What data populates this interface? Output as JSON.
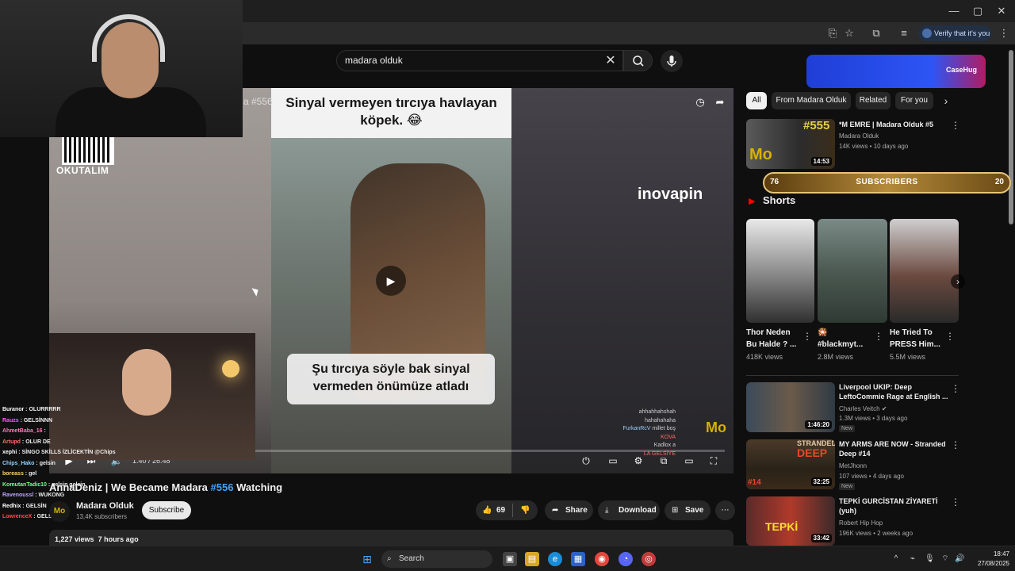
{
  "browser": {
    "verify_label": "Verify that it's you",
    "window_controls": [
      "—",
      "▢",
      "✕"
    ]
  },
  "search": {
    "query": "madara olduk"
  },
  "player": {
    "overlay_title": "a #556",
    "caption_top": "Sinyal vermeyen tırcıya havlayan köpek. 😂",
    "caption_bottom": "Şu tırcıya söyle bak sinyal vermeden önümüze atladı",
    "sponsor": "inovapin",
    "qr_label": "OKUTALIM",
    "time": "1:40 / 26:48",
    "progress": 0.063,
    "logo": "Mo"
  },
  "chat_in_player": [
    {
      "name": "",
      "msg": "ahhahhahshah"
    },
    {
      "name": "",
      "msg": "hahahahaha"
    },
    {
      "name": "FurkanRcV",
      "msg": "millet boş"
    },
    {
      "name": "KOVA",
      "msg": ""
    },
    {
      "name": "Kadlox",
      "msg": "a"
    },
    {
      "name": "",
      "msg": "LA GELSİYE"
    }
  ],
  "chat_left": [
    {
      "name": "Buranor",
      "color": "#ffffff",
      "msg": "OLURRRRR"
    },
    {
      "name": "Rauzs",
      "color": "#ff5cf4",
      "msg": "GELSİNNN"
    },
    {
      "name": "AhmetBaba_16",
      "color": "#ff7ab8",
      "msg": ""
    },
    {
      "name": "Artupd",
      "color": "#ff6b6b",
      "msg": "OLUR DE"
    },
    {
      "name": "xephi",
      "color": "#ffffff",
      "msg": "SİNGO SKİLLS İZLİCEKTİN @Chips"
    },
    {
      "name": "Chips_Hako",
      "color": "#8fd3ff",
      "msg": "gelsin"
    },
    {
      "name": "boreass",
      "color": "#ffd36b",
      "msg": "gel"
    },
    {
      "name": "KomutanTadic10",
      "color": "#7cff8a",
      "msg": "gelsin gelsin"
    },
    {
      "name": "Ravenoussl",
      "color": "#bba8ff",
      "msg": "WUKONG"
    },
    {
      "name": "Redhix",
      "color": "#ffffff",
      "msg": "GELSİN"
    },
    {
      "name": "LowrenceX",
      "color": "#ff4b4b",
      "msg": "GELSİN"
    }
  ],
  "video": {
    "title_prefix": "AnnaDeniz | We Became Madara ",
    "title_hash": "#556",
    "title_suffix": " Watching",
    "channel": "Madara Olduk",
    "subs": "13,4K subscribers",
    "subscribe": "Subscribe",
    "likes": "69",
    "share": "Share",
    "download": "Download",
    "save": "Save",
    "views": "1,227 views",
    "age": "7 hours ago"
  },
  "chips": [
    "All",
    "From Madara Olduk",
    "Related",
    "For you"
  ],
  "subs_bar": {
    "left": "76",
    "label": "SUBSCRIBERS",
    "right": "20"
  },
  "casehug": {
    "label": "CaseHug"
  },
  "shorts_heading": "Shorts",
  "related_top": {
    "title": "*M EMRE | Madara Olduk #5",
    "channel": "Madara Olduk",
    "meta": "14K views • 10 days ago",
    "duration": "14:53",
    "thumb_text": "#555"
  },
  "shorts": [
    {
      "title": "Thor Neden",
      "title2": "Bu Halde ? ...",
      "views": "418K views"
    },
    {
      "title": "🎇",
      "title2": "#blackmyt...",
      "views": "2.8M views"
    },
    {
      "title": "He Tried To",
      "title2": "PRESS Him...",
      "views": "5.5M views"
    }
  ],
  "related": [
    {
      "title": "Liverpool UKIP: Deep",
      "title2": "LeftoCommie Rage at English ...",
      "channel": "Charles Veitch",
      "meta": "1.3M views • 3 days ago",
      "badge": "New",
      "duration": "1:46:20"
    },
    {
      "title": "MY ARMS ARE NOW - Stranded",
      "title2": "Deep #14",
      "channel": "MetJhonn",
      "meta": "107 views • 4 days ago",
      "badge": "New",
      "duration": "32:25"
    },
    {
      "title": "TEPKİ GURCİSTAN ZİYARETİ",
      "title2": "(yuh)",
      "channel": "Robert Hip Hop",
      "meta": "196K views • 2 weeks ago",
      "badge": "",
      "duration": "33:42"
    }
  ],
  "taskbar": {
    "search": "Search",
    "time": "18:47",
    "date": "27/08/2025"
  }
}
